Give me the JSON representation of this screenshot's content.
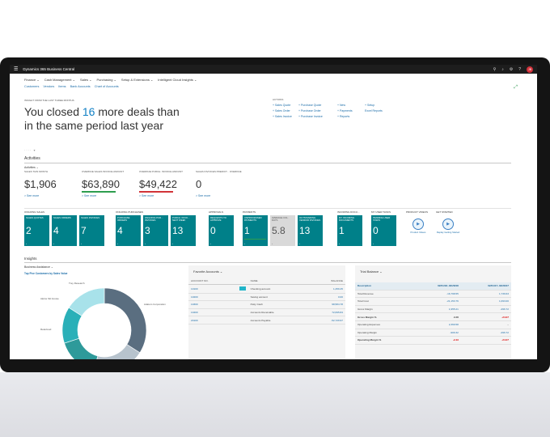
{
  "app_title": "Dynamics 365 Business Central",
  "menu": [
    "Finance ⌄",
    "Cash Management ⌄",
    "Sales ⌄",
    "Purchasing ⌄",
    "Setup & Extensions ⌄",
    "Intelligent Cloud Insights ⌄"
  ],
  "submenu": [
    "Customers",
    "Vendors",
    "Items",
    "Bank Accounts",
    "Chart of Accounts"
  ],
  "headline": {
    "label": "INSIGHT FROM THE LAST THREE MONTHS",
    "pre": "You closed ",
    "num": "16",
    "post": " more deals than in the same period last year"
  },
  "actions": {
    "label": "ACTIONS",
    "items": [
      "+ Sales Quote",
      "+ Purchase Quote",
      "+ New",
      "+ Setup",
      "+ Sales Order",
      "+ Purchase Order",
      "+ Payments",
      "Excel Reports",
      "+ Sales Invoice",
      "+ Purchase Invoice",
      "+ Reports",
      ""
    ]
  },
  "dots": "···· ▾",
  "activities": {
    "title": "Activities",
    "sub": "Activities ⌄",
    "cues": [
      {
        "label": "SALES THIS MONTH",
        "value": "$1,906",
        "bar": "",
        "more": "> See more"
      },
      {
        "label": "OVERDUE SALES INVOICE AMOUNT",
        "value": "$63,890",
        "bar": "#2e9e4f",
        "more": "> See more"
      },
      {
        "label": "OVERDUE PURCH. INVOICE AMOUNT",
        "value": "$49,422",
        "bar": "#d13438",
        "more": "> See more"
      },
      {
        "label": "SALES INVOICES PREDICT... OVERDUE",
        "value": "0",
        "bar": "",
        "more": "> See more"
      }
    ]
  },
  "tile_groups": [
    {
      "label": "ONGOING SALES",
      "tiles": [
        {
          "label": "SALES QUOTES",
          "value": "2"
        },
        {
          "label": "SALES ORDERS",
          "value": "4"
        },
        {
          "label": "SALES INVOICES",
          "value": "7"
        }
      ]
    },
    {
      "label": "ONGOING PURCHASES",
      "tiles": [
        {
          "label": "PURCHASE ORDERS",
          "value": "4"
        },
        {
          "label": "ONGOING PUR... INVOICES",
          "value": "3"
        },
        {
          "label": "PURCH. INVOI... NEXT WEEK",
          "value": "13"
        }
      ]
    },
    {
      "label": "APPROVALS",
      "tiles": [
        {
          "label": "REQUESTS TO APPROVE",
          "value": "0"
        }
      ]
    },
    {
      "label": "PAYMENTS",
      "tiles": [
        {
          "label": "UNPROCESSED PAYMENTS",
          "value": "1"
        },
        {
          "label": "AVERAGE COL. DAYS",
          "value": "5.8",
          "gray": true
        },
        {
          "label": "OUTSTANDING VENDOR INVOICES",
          "value": "13"
        }
      ]
    },
    {
      "label": "INCOMING DOCU...",
      "tiles": [
        {
          "label": "MY INCOMING DOCUMENTS",
          "value": "1"
        }
      ]
    },
    {
      "label": "MY USER TASKS",
      "tiles": [
        {
          "label": "PENDING USER TASKS",
          "value": "0"
        }
      ]
    }
  ],
  "product_videos": {
    "label": "PRODUCT VIDEOS",
    "link": "Product Videos"
  },
  "get_started": {
    "label": "GET STARTED",
    "link": "Replay Getting Started"
  },
  "insights": {
    "title": "Insights",
    "ba_label": "Business Assistance ⌄",
    "ba_sub": "Top Five Customers by Sales Value",
    "chart_data": {
      "type": "pie",
      "title": "Top Five Customers by Sales Value",
      "labels": [
        "Adatum Corporation",
        "",
        "Relecloud",
        "Alpine Ski House",
        "Trey Research"
      ],
      "values": [
        34,
        20,
        16,
        14,
        16
      ],
      "colors": [
        "#5a6e80",
        "#b7c3cd",
        "#2e9a9a",
        "#2ab0b8",
        "#a8e2ea"
      ]
    }
  },
  "favorite_accounts": {
    "title": "Favorite Accounts ⌄",
    "headers": [
      "ACCOUNT NO.",
      "NAME",
      "BALANCE"
    ],
    "rows": [
      [
        "10100",
        "Checking account",
        "1,459.45"
      ],
      [
        "10200",
        "Saving account",
        "0.00"
      ],
      [
        "10300",
        "Petty Cash",
        "98,584.78"
      ],
      [
        "10400",
        "Accounts Receivable",
        "72,695.84"
      ],
      [
        "20100",
        "Accounts Payable",
        "-52,729.97"
      ]
    ]
  },
  "trial_balance": {
    "title": "Trial Balance ⌄",
    "headers": [
      "Description",
      "02/01/18..02/28/18",
      "02/01/17..02/28/17"
    ],
    "rows": [
      [
        "Total Revenue",
        "-16,798.55",
        "1,739.63"
      ],
      [
        "Total Cost",
        "-21,153.76",
        "1,093.00"
      ],
      [
        "Gross Margin",
        "1,955.21",
        "-296.72"
      ],
      [
        "Gross Margin %",
        "2.28",
        "-24.07"
      ],
      [
        "Operating Expenses",
        "2,369.58",
        "–"
      ],
      [
        "Operating Margin",
        "-909.32",
        "-296.72"
      ],
      [
        "Operating Margin %",
        "-2.43",
        "-24.07"
      ]
    ]
  }
}
